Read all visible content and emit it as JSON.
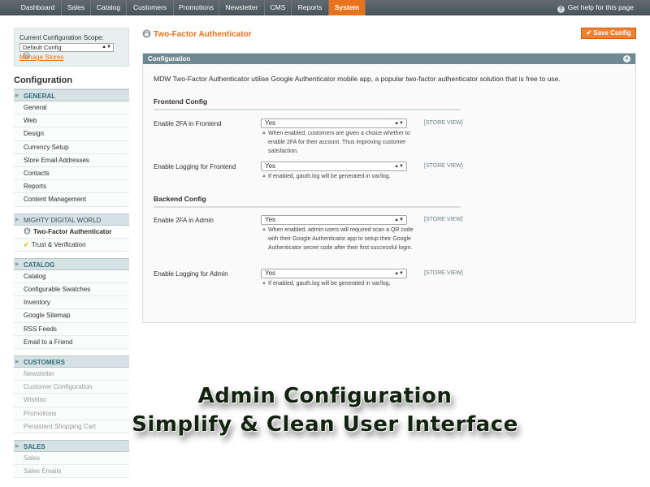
{
  "nav": {
    "items": [
      {
        "label": "Dashboard",
        "active": false
      },
      {
        "label": "Sales",
        "active": false
      },
      {
        "label": "Catalog",
        "active": false
      },
      {
        "label": "Customers",
        "active": false
      },
      {
        "label": "Promotions",
        "active": false
      },
      {
        "label": "Newsletter",
        "active": false
      },
      {
        "label": "CMS",
        "active": false
      },
      {
        "label": "Reports",
        "active": false
      },
      {
        "label": "System",
        "active": true
      }
    ],
    "help": "Get help for this page"
  },
  "sidebar": {
    "scope_label": "Current Configuration Scope:",
    "scope_value": "Default Config",
    "manage_stores": "Manage Stores",
    "title": "Configuration",
    "groups": [
      {
        "heading": "GENERAL",
        "style": "bold",
        "items": [
          {
            "label": "General"
          },
          {
            "label": "Web"
          },
          {
            "label": "Design"
          },
          {
            "label": "Currency Setup"
          },
          {
            "label": "Store Email Addresses"
          },
          {
            "label": "Contacts"
          },
          {
            "label": "Reports"
          },
          {
            "label": "Content Management"
          }
        ]
      },
      {
        "heading": "MIGHTY DIGITAL WORLD",
        "style": "plain",
        "items": [
          {
            "label": "Two-Factor Authenticator",
            "active": true,
            "icon": "lock-icon"
          },
          {
            "label": "Trust & Verification",
            "icon": "check-icon"
          }
        ]
      },
      {
        "heading": "CATALOG",
        "style": "bold",
        "items": [
          {
            "label": "Catalog"
          },
          {
            "label": "Configurable Swatches"
          },
          {
            "label": "Inventory"
          },
          {
            "label": "Google Sitemap"
          },
          {
            "label": "RSS Feeds"
          },
          {
            "label": "Email to a Friend"
          }
        ]
      },
      {
        "heading": "CUSTOMERS",
        "style": "bold",
        "items": [
          {
            "label": "Newsletter",
            "muted": true
          },
          {
            "label": "Customer Configuration",
            "muted": true
          },
          {
            "label": "Wishlist",
            "muted": true
          },
          {
            "label": "Promotions",
            "muted": true
          },
          {
            "label": "Persistent Shopping Cart",
            "muted": true
          }
        ]
      },
      {
        "heading": "SALES",
        "style": "bold",
        "items": [
          {
            "label": "Sales",
            "muted": true
          },
          {
            "label": "Sales Emails",
            "muted": true
          }
        ]
      }
    ]
  },
  "main": {
    "title": "Two-Factor Authenticator",
    "save_label": "Save Config",
    "fieldset_title": "Configuration",
    "intro": "MDW Two-Factor Authenticator utilise Google Authenticator mobile app, a popular two-factor authenticator solution that is free to use.",
    "frontend_heading": "Frontend Config",
    "backend_heading": "Backend Config",
    "rows": [
      {
        "label": "Enable 2FA in Frontend",
        "value": "Yes",
        "scope": "[STORE VIEW]",
        "note": "When enabled, customers are given a choice whether to enable 2FA for their account. Thus improving customer satisfaction."
      },
      {
        "label": "Enable Logging for Frontend",
        "value": "Yes",
        "scope": "[STORE VIEW]",
        "note": "If enabled, gauth.log will be generated in var/log."
      },
      {
        "label": "Enable 2FA in Admin",
        "value": "Yes",
        "scope": "[STORE VIEW]",
        "note": "When enabled, admin users will required scan a QR code with their Google Authenticator app to setup their Google Authenticator secret code after their first successful login."
      },
      {
        "label": "Enable Logging for Admin",
        "value": "Yes",
        "scope": "[STORE VIEW]",
        "note": "If enabled, gauth.log will be generated in var/log."
      }
    ]
  },
  "caption": {
    "line1": "Admin Configuration",
    "line2": "Simplify & Clean User Interface"
  },
  "colors": {
    "accent": "#e8731c",
    "header_bar": "#6f8992",
    "nav_bg": "#4b565b"
  }
}
